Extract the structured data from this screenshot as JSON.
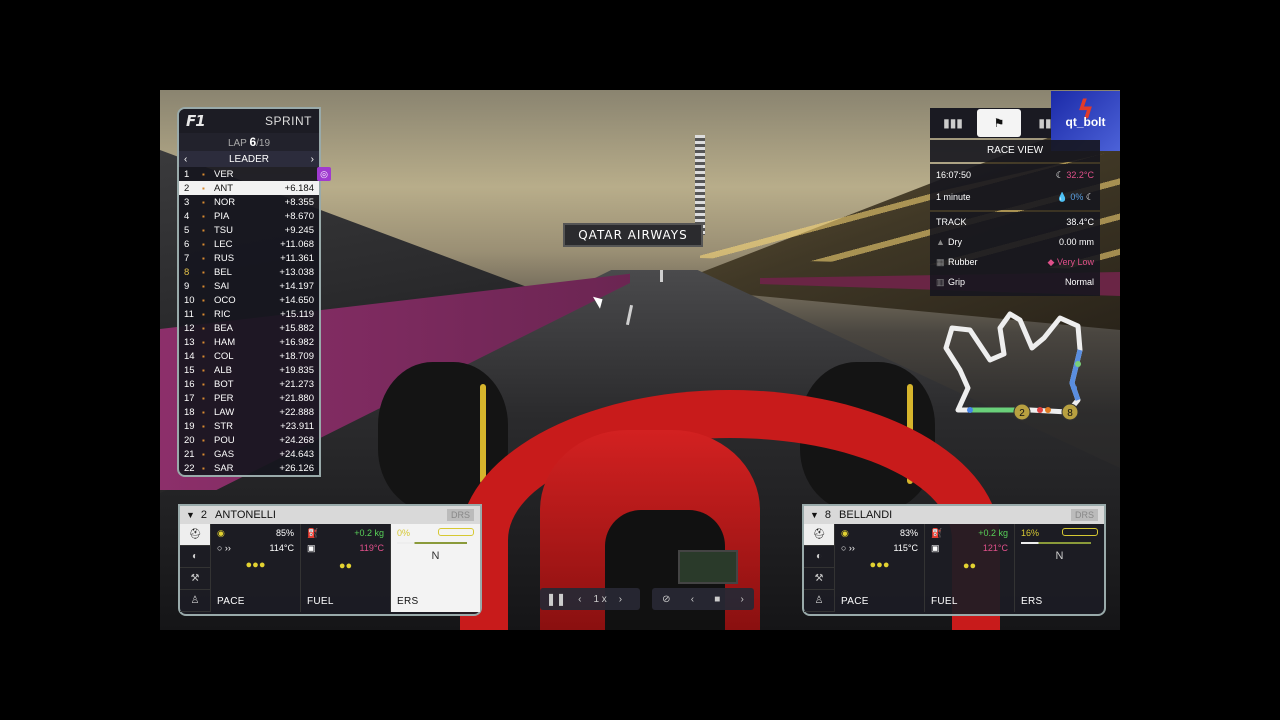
{
  "banner": "QATAR AIRWAYS",
  "leaderboard": {
    "logo": "F1",
    "session": "SPRINT",
    "lap_label": "LAP",
    "lap_current": "6",
    "lap_total": "/19",
    "mode": "LEADER",
    "rows": [
      {
        "pos": "1",
        "drv": "VER",
        "gap": ""
      },
      {
        "pos": "2",
        "drv": "ANT",
        "gap": "+6.184"
      },
      {
        "pos": "3",
        "drv": "NOR",
        "gap": "+8.355"
      },
      {
        "pos": "4",
        "drv": "PIA",
        "gap": "+8.670"
      },
      {
        "pos": "5",
        "drv": "TSU",
        "gap": "+9.245"
      },
      {
        "pos": "6",
        "drv": "LEC",
        "gap": "+11.068"
      },
      {
        "pos": "7",
        "drv": "RUS",
        "gap": "+11.361"
      },
      {
        "pos": "8",
        "drv": "BEL",
        "gap": "+13.038"
      },
      {
        "pos": "9",
        "drv": "SAI",
        "gap": "+14.197"
      },
      {
        "pos": "10",
        "drv": "OCO",
        "gap": "+14.650"
      },
      {
        "pos": "11",
        "drv": "RIC",
        "gap": "+15.119"
      },
      {
        "pos": "12",
        "drv": "BEA",
        "gap": "+15.882"
      },
      {
        "pos": "13",
        "drv": "HAM",
        "gap": "+16.982"
      },
      {
        "pos": "14",
        "drv": "COL",
        "gap": "+18.709"
      },
      {
        "pos": "15",
        "drv": "ALB",
        "gap": "+19.835"
      },
      {
        "pos": "16",
        "drv": "BOT",
        "gap": "+21.273"
      },
      {
        "pos": "17",
        "drv": "PER",
        "gap": "+21.880"
      },
      {
        "pos": "18",
        "drv": "LAW",
        "gap": "+22.888"
      },
      {
        "pos": "19",
        "drv": "STR",
        "gap": "+23.911"
      },
      {
        "pos": "20",
        "drv": "POU",
        "gap": "+24.268"
      },
      {
        "pos": "21",
        "drv": "GAS",
        "gap": "+24.643"
      },
      {
        "pos": "22",
        "drv": "SAR",
        "gap": "+26.126"
      }
    ]
  },
  "race_view": {
    "title": "RACE VIEW",
    "time": "16:07:50",
    "temp_air": "32.2°C",
    "forecast": "1 minute",
    "rain_chance": "0%",
    "track_label": "TRACK",
    "track_temp": "38.4°C",
    "dry_label": "Dry",
    "dry_value": "0.00 mm",
    "rubber_label": "Rubber",
    "rubber_value": "Very Low",
    "grip_label": "Grip",
    "grip_value": "Normal"
  },
  "streamer": {
    "name": "qt_bolt"
  },
  "cards": [
    {
      "num": "2",
      "name": "ANTONELLI",
      "drs": "DRS",
      "pace_val": "85%",
      "temp": "114°C",
      "fuel_val": "+0.2 kg",
      "fuel_temp": "119°C",
      "ers_val": "0%",
      "ers_mode": "N",
      "pace_label": "PACE",
      "fuel_label": "FUEL",
      "ers_label": "ERS"
    },
    {
      "num": "8",
      "name": "BELLANDI",
      "drs": "DRS",
      "pace_val": "83%",
      "temp": "115°C",
      "fuel_val": "+0.2 kg",
      "fuel_temp": "121°C",
      "ers_val": "16%",
      "ers_mode": "N",
      "pace_label": "PACE",
      "fuel_label": "FUEL",
      "ers_label": "ERS"
    }
  ],
  "playback": {
    "speed": "1 x"
  },
  "minimap": {
    "marker_a": "2",
    "marker_b": "8"
  },
  "colors": {
    "accent_purple": "#a03ad0",
    "ers_yellow": "#d6c833",
    "rubber_pink": "#e0508a",
    "fuel_green": "#58d058"
  }
}
